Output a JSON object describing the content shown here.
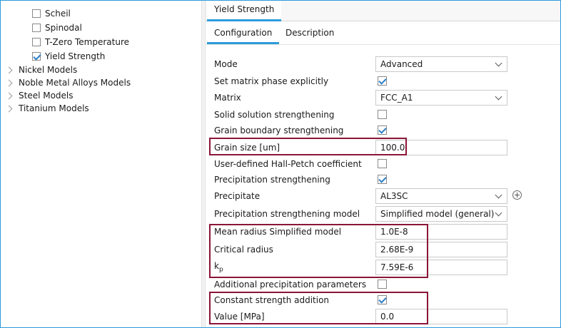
{
  "tree": {
    "checkbox_items": [
      {
        "label": "Scheil",
        "checked": false
      },
      {
        "label": "Spinodal",
        "checked": false
      },
      {
        "label": "T-Zero Temperature",
        "checked": false
      },
      {
        "label": "Yield Strength",
        "checked": true
      }
    ],
    "groups": [
      {
        "label": "Nickel Models"
      },
      {
        "label": "Noble Metal Alloys Models"
      },
      {
        "label": "Steel Models"
      },
      {
        "label": "Titanium Models"
      }
    ]
  },
  "panel": {
    "title_tab": "Yield Strength",
    "tabs": [
      {
        "label": "Configuration",
        "active": true
      },
      {
        "label": "Description",
        "active": false
      }
    ],
    "fields": {
      "mode": {
        "label": "Mode",
        "value": "Advanced"
      },
      "set_matrix": {
        "label": "Set matrix phase explicitly",
        "checked": true
      },
      "matrix": {
        "label": "Matrix",
        "value": "FCC_A1"
      },
      "solid_solution": {
        "label": "Solid solution strengthening",
        "checked": false
      },
      "grain_boundary": {
        "label": "Grain boundary strengthening",
        "checked": true
      },
      "grain_size": {
        "label": "Grain size [um]",
        "value": "100.0"
      },
      "hall_petch": {
        "label": "User-defined Hall-Petch coefficient",
        "checked": false
      },
      "precipitation": {
        "label": "Precipitation strengthening",
        "checked": true
      },
      "precipitate": {
        "label": "Precipitate",
        "value": "AL3SC"
      },
      "precip_model": {
        "label": "Precipitation strengthening model",
        "value": "Simplified model (general)"
      },
      "mean_radius": {
        "label": "Mean radius Simplified model",
        "value": "1.0E-8"
      },
      "critical_radius": {
        "label": "Critical radius",
        "value": "2.68E-9"
      },
      "kp": {
        "label": "k",
        "subscript": "p",
        "value": "7.59E-6"
      },
      "additional_params": {
        "label": "Additional precipitation parameters",
        "checked": false
      },
      "constant_strength": {
        "label": "Constant strength addition",
        "checked": true
      },
      "value_mpa": {
        "label": "Value [MPa]",
        "value": "0.0"
      }
    }
  },
  "colors": {
    "accent": "#2d9bdb",
    "highlight_box": "#8b1538",
    "check": "#2d7fc9"
  },
  "icons": {
    "add_precipitate": "plus-circle-icon",
    "tree_expand": "chevron-right-icon",
    "dropdown": "chevron-down-icon"
  }
}
